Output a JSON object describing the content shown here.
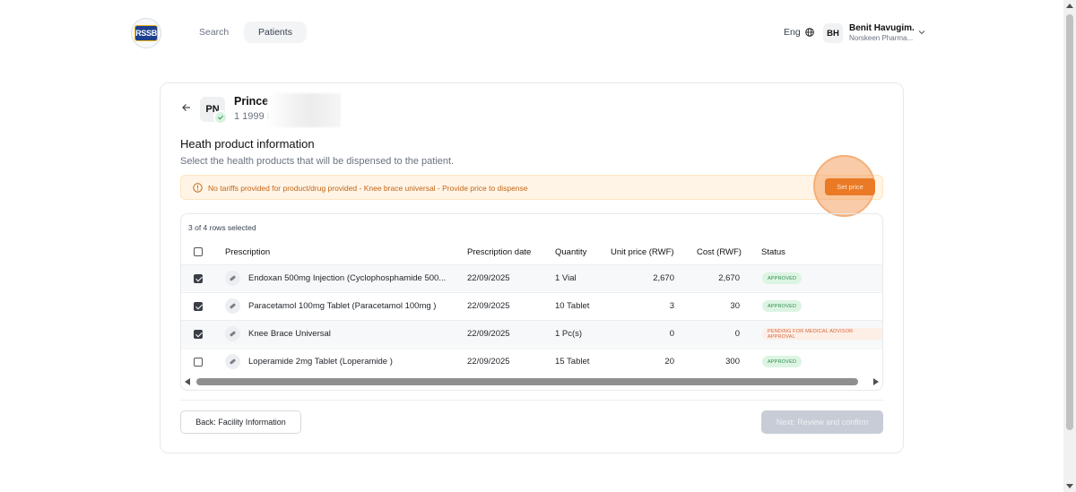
{
  "nav": {
    "logo_text": "RSSB",
    "tabs": [
      {
        "label": "Search"
      },
      {
        "label": "Patients"
      }
    ],
    "language": "Eng",
    "user": {
      "initials": "BH",
      "name": "Benit Havugim...",
      "org": "Norskeen Pharma..."
    }
  },
  "patient": {
    "initials": "PN",
    "name": "Prince",
    "id": "1 1999 8"
  },
  "section": {
    "title": "Heath product information",
    "subtitle": "Select the health products that will be dispensed to the patient."
  },
  "alert": {
    "message": "No tariffs provided for product/drug provided - Knee brace universal - Provide price to dispense",
    "button": "Set price"
  },
  "table": {
    "rows_selected": "3 of 4 rows selected",
    "columns": [
      "Prescription",
      "Prescription date",
      "Quantity",
      "Unit price (RWF)",
      "Cost (RWF)",
      "Status"
    ],
    "rows": [
      {
        "checked": true,
        "prescription": "Endoxan 500mg Injection (Cyclophosphamide 500...",
        "date": "22/09/2025",
        "quantity": "1 Vial",
        "unit_price": "2,670",
        "cost": "2,670",
        "status": "APPROVED"
      },
      {
        "checked": true,
        "prescription": "Paracetamol 100mg Tablet (Paracetamol 100mg )",
        "date": "22/09/2025",
        "quantity": "10 Tablet",
        "unit_price": "3",
        "cost": "30",
        "status": "APPROVED"
      },
      {
        "checked": true,
        "prescription": "Knee Brace Universal",
        "date": "22/09/2025",
        "quantity": "1 Pc(s)",
        "unit_price": "0",
        "cost": "0",
        "status": "PENDING FOR MEDICAL ADVISOR APPROVAL"
      },
      {
        "checked": false,
        "prescription": "Loperamide 2mg Tablet (Loperamide )",
        "date": "22/09/2025",
        "quantity": "15 Tablet",
        "unit_price": "20",
        "cost": "300",
        "status": "APPROVED"
      }
    ]
  },
  "footer": {
    "back": "Back: Facility Information",
    "next": "Next: Review and confirm"
  },
  "colors": {
    "accent": "#ea7a26",
    "approved": "#2f8a4b",
    "pending": "#d2693d"
  }
}
